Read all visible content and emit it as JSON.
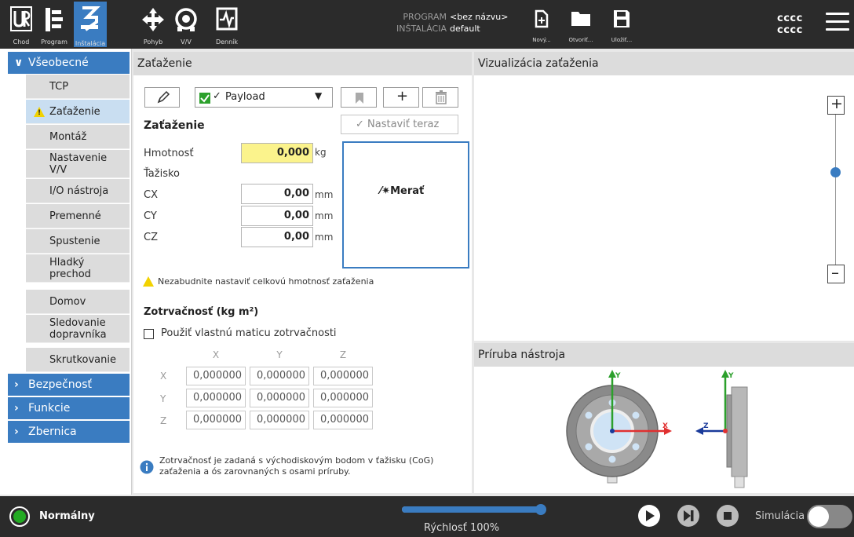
{
  "topbar": {
    "tabs": [
      {
        "label": "Chod",
        "icon": "ur-logo-icon"
      },
      {
        "label": "Program",
        "icon": "program-icon"
      },
      {
        "label": "Inštalácia",
        "icon": "installation-icon",
        "active": true
      },
      {
        "label": "Pohyb",
        "icon": "move-icon"
      },
      {
        "label": "V/V",
        "icon": "io-icon"
      },
      {
        "label": "Denník",
        "icon": "log-icon"
      }
    ],
    "program_key": "PROGRAM",
    "program_value": "<bez názvu>",
    "installation_key": "INŠTALÁCIA",
    "installation_value": "default",
    "file_buttons": [
      {
        "label": "Nový...",
        "icon": "new-file-icon"
      },
      {
        "label": "Otvoriť...",
        "icon": "open-folder-icon"
      },
      {
        "label": "Uložiť...",
        "icon": "save-icon"
      }
    ],
    "user_line1": "cccc",
    "user_line2": "cccc"
  },
  "sidebar": {
    "sections": [
      {
        "label": "Všeobecné",
        "expanded": true
      },
      {
        "label": "Bezpečnosť",
        "expanded": false
      },
      {
        "label": "Funkcie",
        "expanded": false
      },
      {
        "label": "Zbernica",
        "expanded": false
      }
    ],
    "items": [
      {
        "label": "TCP"
      },
      {
        "label": "Zaťaženie",
        "selected": true,
        "warning": true
      },
      {
        "label": "Montáž"
      },
      {
        "label": "Nastavenie V/V"
      },
      {
        "label": "I/O nástroja"
      },
      {
        "label": "Premenné"
      },
      {
        "label": "Spustenie"
      },
      {
        "label": "Hladký prechod"
      },
      {
        "label": "Domov"
      },
      {
        "label": "Sledovanie dopravníka"
      },
      {
        "label": "Skrutkovanie"
      }
    ]
  },
  "payload_panel": {
    "title": "Zaťaženie",
    "payload_select": "Payload",
    "set_now_button": "Nastaviť teraz",
    "section_title": "Zaťaženie",
    "mass_label": "Hmotnosť",
    "mass_value": "0,000",
    "mass_unit": "kg",
    "cog_label": "Ťažisko",
    "cx_label": "CX",
    "cx_value": "0,00",
    "cx_unit": "mm",
    "cy_label": "CY",
    "cy_value": "0,00",
    "cy_unit": "mm",
    "cz_label": "CZ",
    "cz_value": "0,00",
    "cz_unit": "mm",
    "measure_button": "Merať",
    "warning_text": "Nezabudnite nastaviť celkovú hmotnosť zaťaženia",
    "inertia_title": "Zotrvačnosť (kg m²)",
    "inertia_checkbox": "Použiť vlastnú maticu zotrvačnosti",
    "matrix_cols": [
      "X",
      "Y",
      "Z"
    ],
    "matrix_rows": [
      "X",
      "Y",
      "Z"
    ],
    "matrix_values": [
      [
        "0,000000",
        "0,000000",
        "0,000000"
      ],
      [
        "0,000000",
        "0,000000",
        "0,000000"
      ],
      [
        "0,000000",
        "0,000000",
        "0,000000"
      ]
    ],
    "info_text_line1": "Zotrvačnosť je zadaná s východiskovým bodom v ťažisku (CoG)",
    "info_text_line2": "zaťaženia a ós zarovnaných s osami príruby."
  },
  "viz_panel": {
    "title": "Vizualizácia zaťaženia",
    "zoom_level": 0.62
  },
  "flange_panel": {
    "title": "Príruba nástroja",
    "axis_y": "Y",
    "axis_x": "X",
    "axis_z": "Z"
  },
  "bottombar": {
    "status": "Normálny",
    "speed_label": "Rýchlosť 100%",
    "speed_value": 1.0,
    "simulation_label": "Simulácia"
  },
  "colors": {
    "accent": "#3a7cc1",
    "selected": "#c9def1",
    "warning": "#f2d200",
    "status_green": "#22aa22",
    "mass_field": "#fbf38c"
  }
}
